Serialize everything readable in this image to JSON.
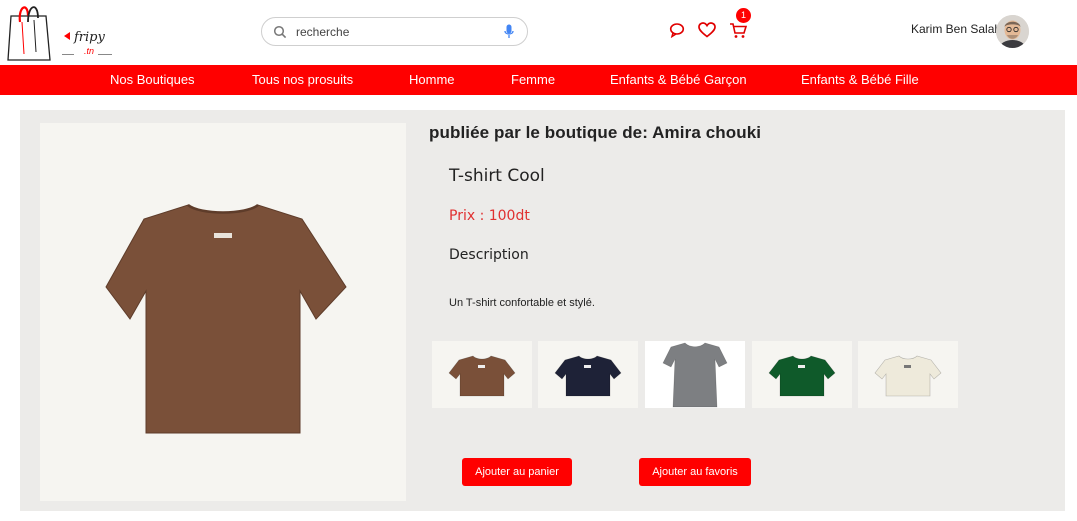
{
  "brand": {
    "logo_text": "fripy",
    "logo_suffix": ".tn"
  },
  "search": {
    "placeholder": "recherche"
  },
  "header": {
    "cart_count": "1",
    "user_name": "Karim Ben Salah"
  },
  "nav": [
    "Nos Boutiques",
    "Tous nos prosuits",
    "Homme",
    "Femme",
    "Enfants & Bébé Garçon",
    "Enfants & Bébé Fille"
  ],
  "product": {
    "shop_title": "publiée par le boutique de: Amira chouki",
    "name": "T-shirt Cool",
    "price": "Prix : 100dt",
    "description_heading": "Description",
    "description": "Un T-shirt confortable et stylé.",
    "main_color": "#7a5039",
    "thumbnails": [
      {
        "color": "#7a5039",
        "type": "tshirt"
      },
      {
        "color": "#1e2237",
        "type": "tshirt"
      },
      {
        "color": "#7d7f82",
        "type": "fitted-tee"
      },
      {
        "color": "#0f5a2a",
        "type": "tshirt"
      },
      {
        "color": "#eeeadb",
        "type": "tshirt"
      }
    ]
  },
  "actions": {
    "add_to_cart": "Ajouter au panier",
    "add_to_favorites": "Ajouter au favoris"
  },
  "colors": {
    "accent": "#ff0000",
    "panel": "#ecebe9",
    "price": "#e03030"
  }
}
